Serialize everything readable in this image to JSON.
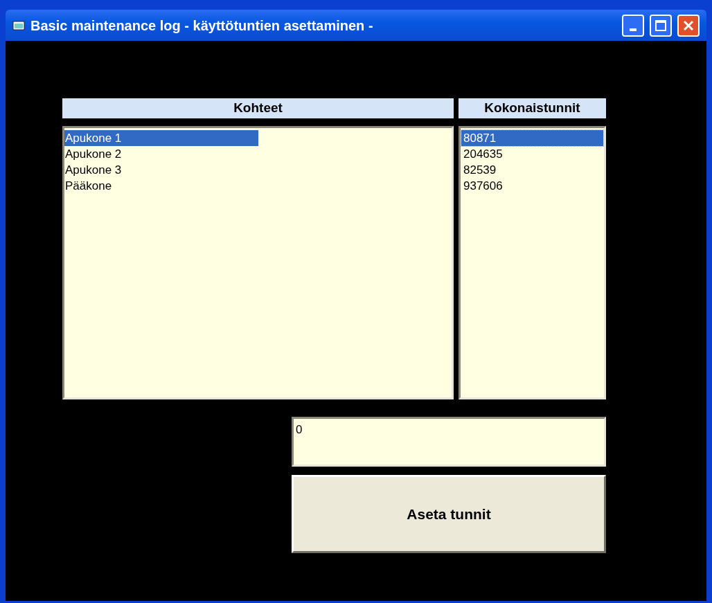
{
  "window": {
    "title": "Basic maintenance log - käyttötuntien asettaminen -"
  },
  "columns": [
    "Kohteet",
    "Kokonaistunnit"
  ],
  "items": [
    {
      "name": "Apukone 1",
      "hours": "80871",
      "selected": true
    },
    {
      "name": "Apukone 2",
      "hours": "204635",
      "selected": false
    },
    {
      "name": "Apukone 3",
      "hours": "82539",
      "selected": false
    },
    {
      "name": "Pääkone",
      "hours": "937606",
      "selected": false
    }
  ],
  "hours_field": {
    "value": "0"
  },
  "buttons": [
    "Aseta tunnit"
  ]
}
